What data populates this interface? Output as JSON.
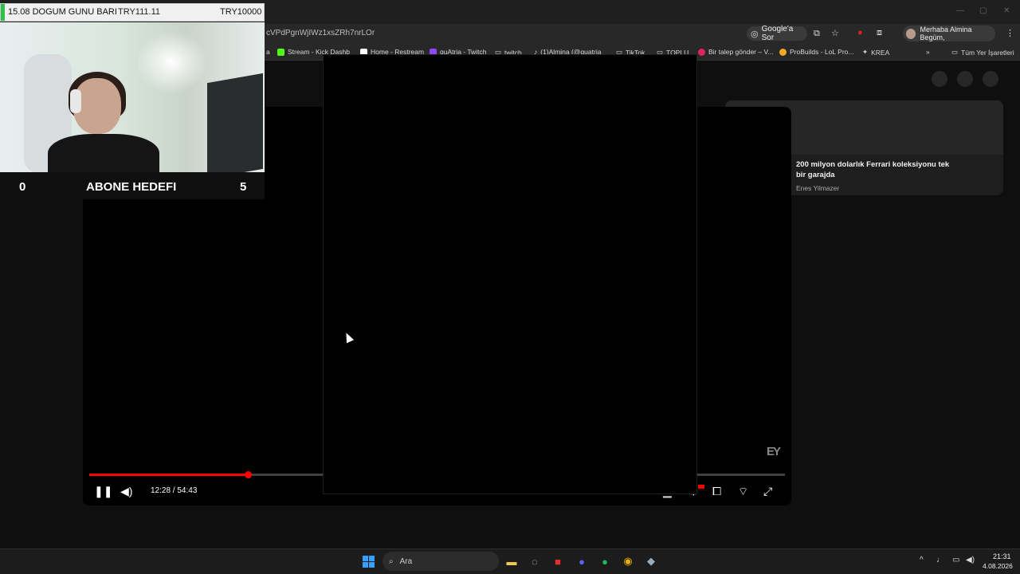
{
  "browser": {
    "address_text": "cVPdPgnWjIWz1xsZRh7nrLOr",
    "google_ask_label": "Google'a Sor",
    "profile_label": "Merhaba Almina Begüm,",
    "bookmarks": [
      {
        "label": "Stream - Kick Dashb",
        "color": "#53fc18"
      },
      {
        "label": "Home - Restream",
        "color": "#ffffff"
      },
      {
        "label": "quAtria - Twitch",
        "color": "#9146ff"
      },
      {
        "label": "twitch",
        "color": "#bbbbbb"
      },
      {
        "label": "(1)Almina (@quatria",
        "color": "#ffffff"
      },
      {
        "label": "TikTok",
        "color": "#bbbbbb"
      },
      {
        "label": "TOPLU",
        "color": "#bbbbbb"
      },
      {
        "label": "Bir talep gönder – V...",
        "color": "#e0245e"
      },
      {
        "label": "ProBuilds - LoL Pro...",
        "color": "#f5a623"
      },
      {
        "label": "KREA",
        "color": "#dddddd"
      }
    ],
    "all_bookmarks_label": "Tüm Yer İşaretleri"
  },
  "overlay": {
    "donation_title": "15.08 DOGUM GUNU BARI",
    "donation_current": "TRY111.11",
    "donation_goal": "TRY10000",
    "donation_progress_fraction": 0.011,
    "sub_current": "0",
    "sub_title": "ABONE HEDEFI",
    "sub_target": "5"
  },
  "player": {
    "time_display": "12:28 / 54:43",
    "progress_fraction": 0.228,
    "watermark": "EY",
    "accent_color": "#ff0000"
  },
  "sidebar": {
    "rec_title": "200 milyon dolarlık Ferrari koleksiyonu tek bir garajda",
    "rec_channel": "Enes Yilmazer"
  },
  "taskbar": {
    "search_label": "Ara",
    "clock_time": "21:31",
    "clock_date": "4.08.2026"
  }
}
